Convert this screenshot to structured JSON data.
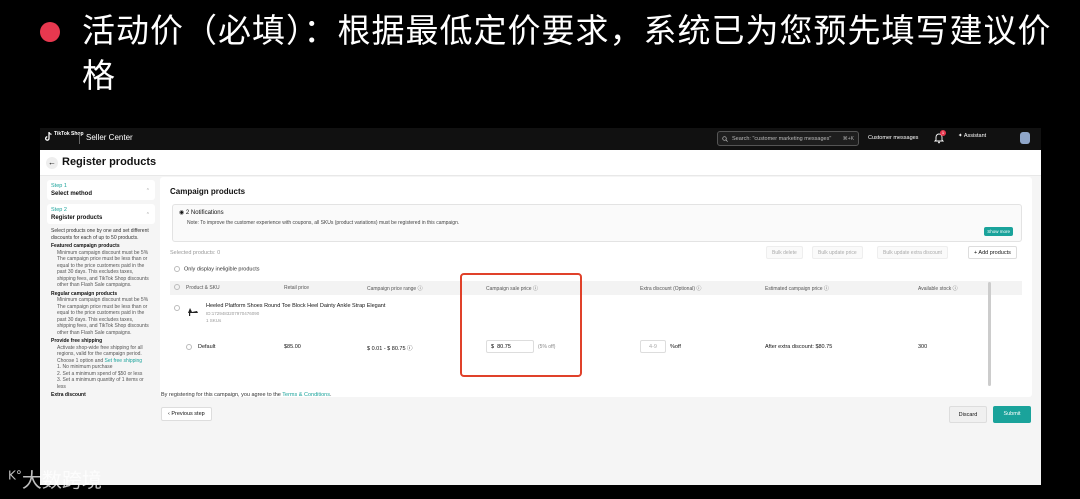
{
  "slide": {
    "headline": "活动价（必填）：根据最低定价要求，系统已为您预先填写建议价格",
    "watermark": "大数跨境"
  },
  "topbar": {
    "logo_text": "TikTok Shop",
    "center_title": "Seller Center",
    "search_placeholder": "Search: \"customer marketing messages\"",
    "search_shortcut": "⌘+K",
    "customer_messages": "Customer messages",
    "notification_count": "1",
    "assistant": "Assistant"
  },
  "page": {
    "title": "Register products"
  },
  "steps": [
    {
      "label": "Step 1",
      "name": "Select method"
    },
    {
      "label": "Step 2",
      "name": "Register products"
    }
  ],
  "guide": {
    "intro": "Select products one by one and set different discounts for each of up to 50 products.",
    "featured_title": "Featured campaign products",
    "featured_items": [
      "Minimum campaign discount must be 5%",
      "The campaign price must be less than or equal to the price customers paid in the past 30 days. This excludes taxes, shipping fees, and TikTok Shop discounts other than Flash Sale campaigns."
    ],
    "regular_title": "Regular campaign products",
    "regular_items": [
      "Minimum campaign discount must be 5%",
      "The campaign price must be less than or equal to the price customers paid in the past 30 days. This excludes taxes, shipping fees, and TikTok Shop discounts other than Flash Sale campaigns."
    ],
    "shipping_title": "Provide free shipping",
    "shipping_text": "Activate shop-wide free shipping for all regions, valid for the campaign period. Choose 1 option and",
    "shipping_link": "Set free shipping",
    "shipping_options": [
      "1. No minimum purchase",
      "2. Set a minimum spend of $50 or less",
      "3. Set a minimum quantity of 1 items or less"
    ],
    "extra_title": "Extra discount"
  },
  "campaign": {
    "title": "Campaign products",
    "notifications_title": "2 Notifications",
    "notifications_body": "Note: To improve the customer experience with coupons, all SKUs (product variations) must be registered in this campaign.",
    "show_more": "Show more",
    "selected": "Selected products: 0",
    "bulk_delete": "Bulk delete",
    "bulk_price": "Bulk update price",
    "bulk_extra": "Bulk update extra discount",
    "add_products": "+ Add products",
    "only_ineligible": "Only display ineligible products",
    "columns": [
      "Product & SKU",
      "Retail price",
      "Campaign price range ⓘ",
      "Campaign sale price ⓘ",
      "Extra discount (Optional) ⓘ",
      "Estimated campaign price ⓘ",
      "Available stock ⓘ"
    ],
    "product": {
      "name": "Heeled Platform Shoes Round Toe Block Heel Dainty Ankle Strap Elegant",
      "id": "ID:1729483207970476090",
      "skus": "1 SKUs"
    },
    "sku_row": {
      "sku": "Default",
      "retail_price": "$85.00",
      "price_range": "$ 0.01 - $ 80.75 ⓘ",
      "currency": "$",
      "sale_price": "80.75",
      "sale_discount": "(5% off)",
      "extra_placeholder": "4-9",
      "extra_unit": "%off",
      "estimated": "After extra discount: $80.75",
      "stock": "300"
    }
  },
  "footer": {
    "agree_text": "By registering for this campaign, you agree to the",
    "terms_link": "Terms & Conditions",
    "agree_end": ".",
    "prev_step": "‹ Previous step",
    "discard": "Discard",
    "submit": "Submit"
  },
  "colors": {
    "accent": "#1aa39b",
    "bullet": "#e8384f",
    "highlight": "#e0412a"
  }
}
